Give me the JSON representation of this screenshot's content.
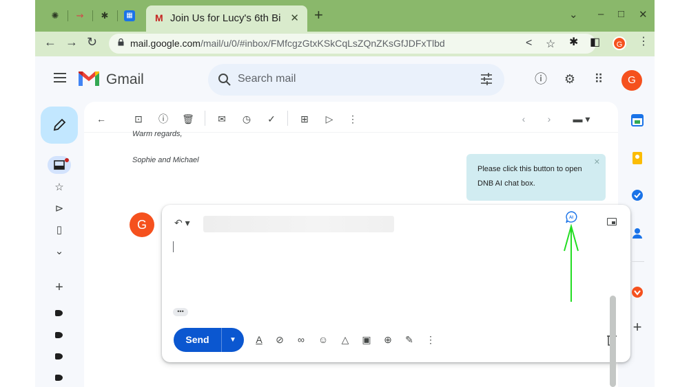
{
  "browser": {
    "tab_title": "Join Us for Lucy's 6th Bir",
    "tab_favicon": "M",
    "new_tab": "+",
    "url_host": "mail.google.com",
    "url_path": "/mail/u/0/#inbox/FMfcgzGtxKSkCqLsZQnZKsGfJDFxTlbd",
    "profile_initial": "G"
  },
  "gmail": {
    "logo_text": "Gmail",
    "search_placeholder": "Search mail",
    "avatar_initial": "G"
  },
  "message": {
    "closing": "Warm regards,",
    "signature": "Sophie and Michael",
    "sender_initial": "G"
  },
  "tooltip": {
    "text": "Please click this button to open DNB AI chat box."
  },
  "reply": {
    "ai_label": "AI",
    "trimmed": "•••",
    "send_label": "Send"
  },
  "colors": {
    "accent": "#0b57d0",
    "avatar": "#f5511e",
    "arrow": "#22dd22",
    "tooltip_bg": "#d1ecf1"
  }
}
